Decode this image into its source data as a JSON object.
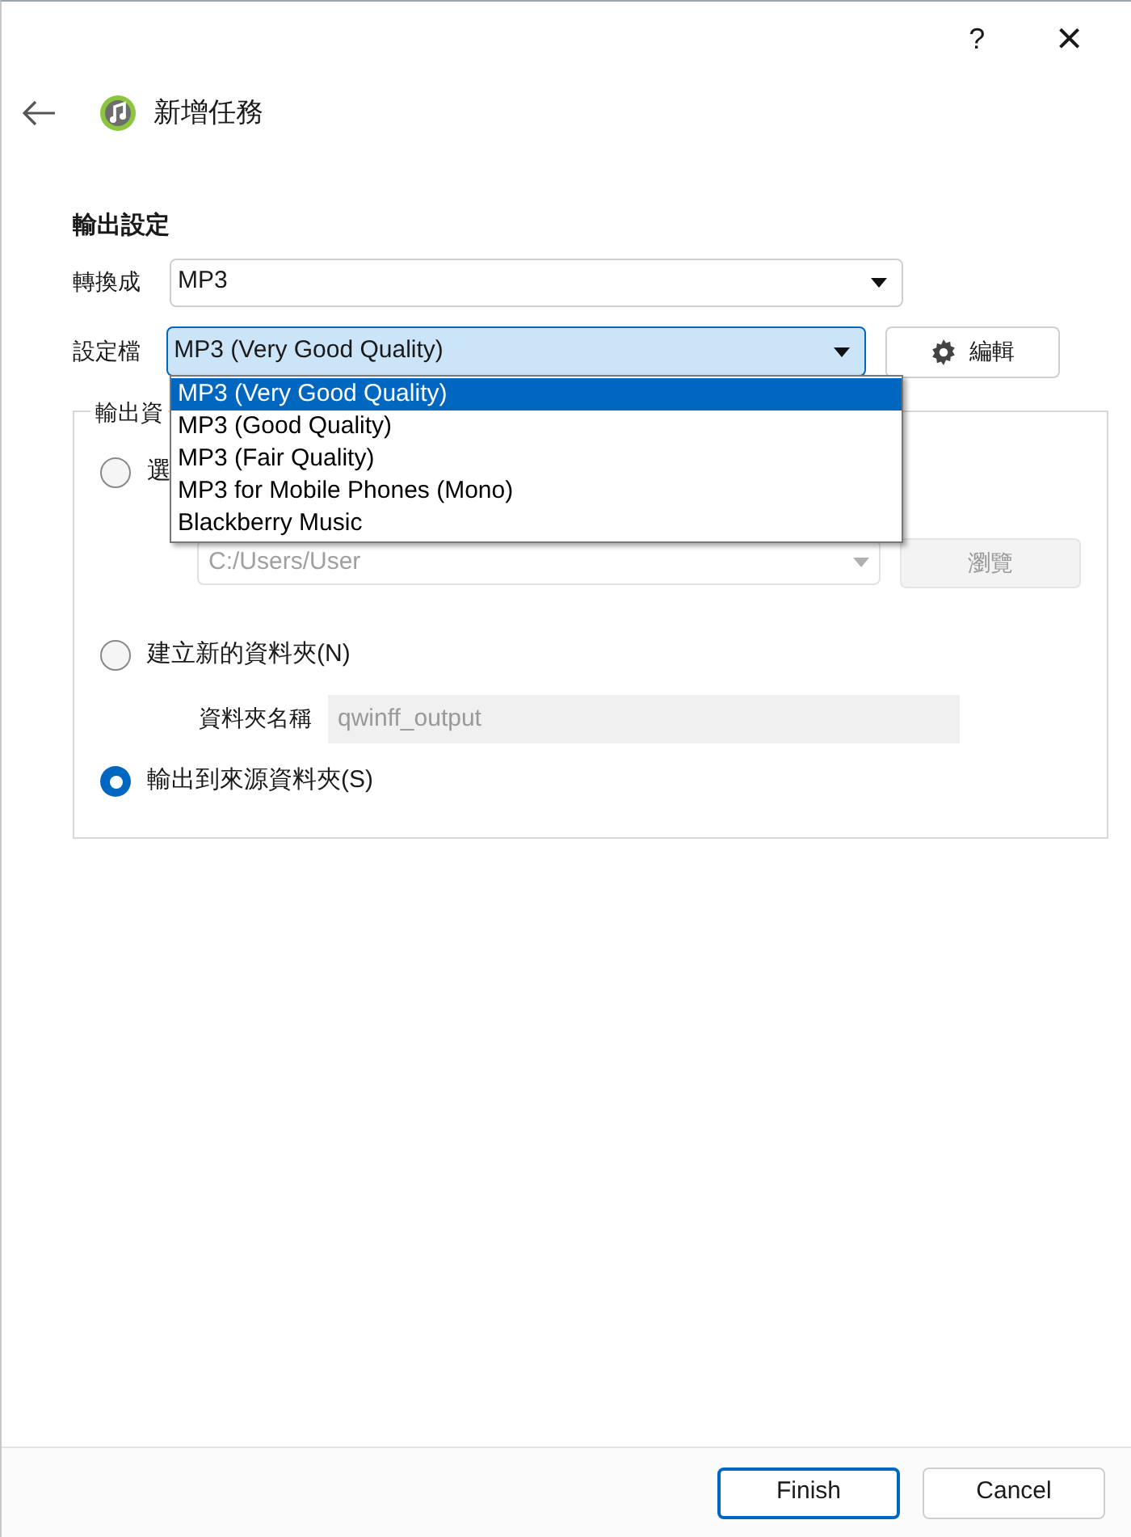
{
  "window": {
    "help": "?",
    "close": "×"
  },
  "header": {
    "title": "新增任務"
  },
  "section_title": "輸出設定",
  "convert_to": {
    "label": "轉換成",
    "value": "MP3"
  },
  "preset": {
    "label": "設定檔",
    "value": "MP3 (Very Good Quality)",
    "expanded": true,
    "edit_button": "編輯",
    "options": [
      {
        "label": "MP3 (Very Good Quality)",
        "selected": true
      },
      {
        "label": "MP3 (Good Quality)",
        "selected": false
      },
      {
        "label": "MP3 (Fair Quality)",
        "selected": false
      },
      {
        "label": "MP3 for Mobile Phones (Mono)",
        "selected": false
      },
      {
        "label": "Blackberry Music",
        "selected": false
      }
    ]
  },
  "output_group": {
    "title": "輸出資",
    "options": [
      {
        "kind": "path",
        "label": "選",
        "selected": false,
        "value": "C:/Users/User",
        "button": "瀏覽"
      },
      {
        "kind": "newfolder",
        "label": "建立新的資料夾(N)",
        "selected": false,
        "field_label": "資料夾名稱",
        "placeholder": "qwinff_output"
      },
      {
        "kind": "plain",
        "label": "輸出到來源資料夾(S)",
        "selected": true
      }
    ]
  },
  "buttons": [
    {
      "label": "Finish",
      "default": true
    },
    {
      "label": "Cancel",
      "default": false
    }
  ]
}
